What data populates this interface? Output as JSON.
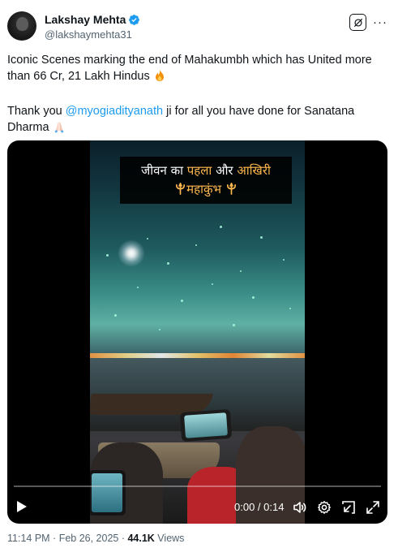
{
  "author": {
    "display_name": "Lakshay Mehta",
    "handle": "@lakshaymehta31",
    "verified": true,
    "avatar_icon": "avatar-photo"
  },
  "header_actions": {
    "grok_icon": "grok-icon",
    "more_label": "···"
  },
  "tweet": {
    "line1_text": "Iconic Scenes marking the end of Mahakumbh which has United more than 66 Cr, 21 Lakh Hindus",
    "line1_emoji": "fire-emoji",
    "line2_before": "Thank you ",
    "mention": "@myogiadityanath",
    "line2_after": " ji for all you have done for Sanatana Dharma",
    "line2_emoji": "folded-hands-emoji"
  },
  "video": {
    "caption_part1": "जीवन का ",
    "caption_highlight1": "पहला",
    "caption_part2": " और ",
    "caption_highlight2": "आखिरी",
    "caption_line2": "महाकुंभ",
    "caption_trident_icon": "trident-icon",
    "current_time": "0:00",
    "separator": " / ",
    "duration": "0:14",
    "progress_fraction": 0.0,
    "controls": [
      "play-icon",
      "volume-icon",
      "settings-icon",
      "pip-icon",
      "fullscreen-icon"
    ]
  },
  "meta": {
    "time": "11:14 PM",
    "dot1": " · ",
    "date": "Feb 26, 2025",
    "dot2": " · ",
    "views_count": "44.1K",
    "views_label": " Views"
  },
  "colors": {
    "link": "#1d9bf0",
    "text": "#0f1419",
    "secondary": "#536471",
    "verified": "#1d9bf0",
    "caption_highlight": "#ffb84d"
  }
}
